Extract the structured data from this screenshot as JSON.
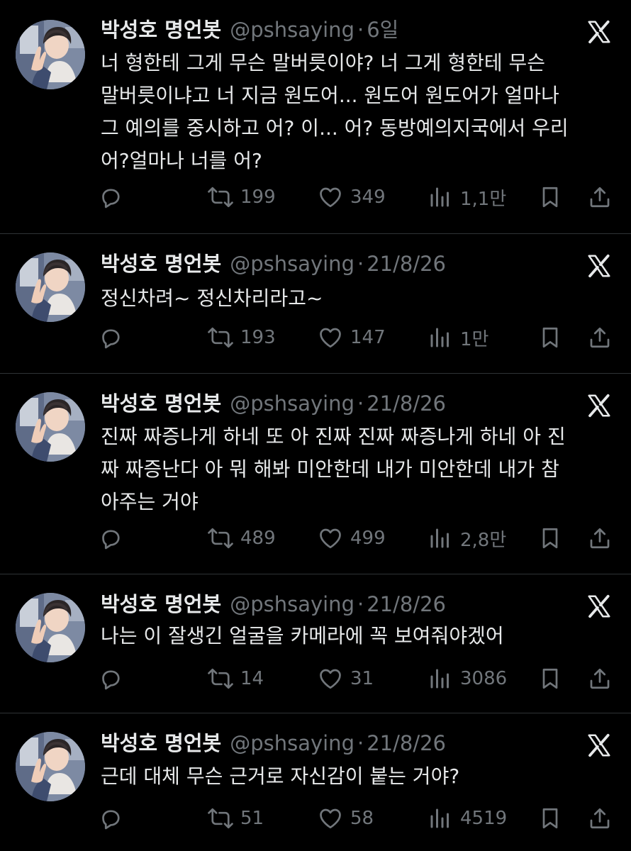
{
  "icons": {
    "reply": "reply-icon",
    "retweet": "retweet-icon",
    "like": "heart-icon",
    "views": "views-icon",
    "bookmark": "bookmark-icon",
    "share": "share-icon",
    "platform": "x-logo-icon"
  },
  "colors": {
    "background": "#000000",
    "text": "#e7e9ea",
    "muted": "#71767b",
    "divider": "#2f3336"
  },
  "tweets": [
    {
      "name": "박성호 명언봇",
      "handle": "@pshsaying",
      "dot": "·",
      "time": "6일",
      "text": "너 형한테 그게 무슨 말버릇이야? 너 그게 형한테 무슨\n말버릇이냐고 너 지금 원도어... 원도어 원도어가 얼마나\n그 예의를 중시하고 어? 이... 어? 동방예의지국에서 우리\n어?얼마나 너를 어?",
      "replies": "",
      "retweets": "199",
      "likes": "349",
      "views": "1,1만"
    },
    {
      "name": "박성호 명언봇",
      "handle": "@pshsaying",
      "dot": "·",
      "time": "21/8/26",
      "text": "정신차려~ 정신차리라고~",
      "replies": "",
      "retweets": "193",
      "likes": "147",
      "views": "1만"
    },
    {
      "name": "박성호 명언봇",
      "handle": "@pshsaying",
      "dot": "·",
      "time": "21/8/26",
      "text": "진짜 짜증나게 하네 또 아 진짜 진짜 짜증나게 하네 아 진\n짜 짜증난다 아 뭐 해봐 미안한데 내가 미안한데 내가 참\n아주는 거야",
      "replies": "",
      "retweets": "489",
      "likes": "499",
      "views": "2,8만"
    },
    {
      "name": "박성호 명언봇",
      "handle": "@pshsaying",
      "dot": "·",
      "time": "21/8/26",
      "text": "나는 이 잘생긴 얼굴을 카메라에 꼭 보여줘야겠어",
      "replies": "",
      "retweets": "14",
      "likes": "31",
      "views": "3086"
    },
    {
      "name": "박성호 명언봇",
      "handle": "@pshsaying",
      "dot": "·",
      "time": "21/8/26",
      "text": "근데 대체 무슨 근거로 자신감이 붙는 거야?",
      "replies": "",
      "retweets": "51",
      "likes": "58",
      "views": "4519"
    }
  ]
}
